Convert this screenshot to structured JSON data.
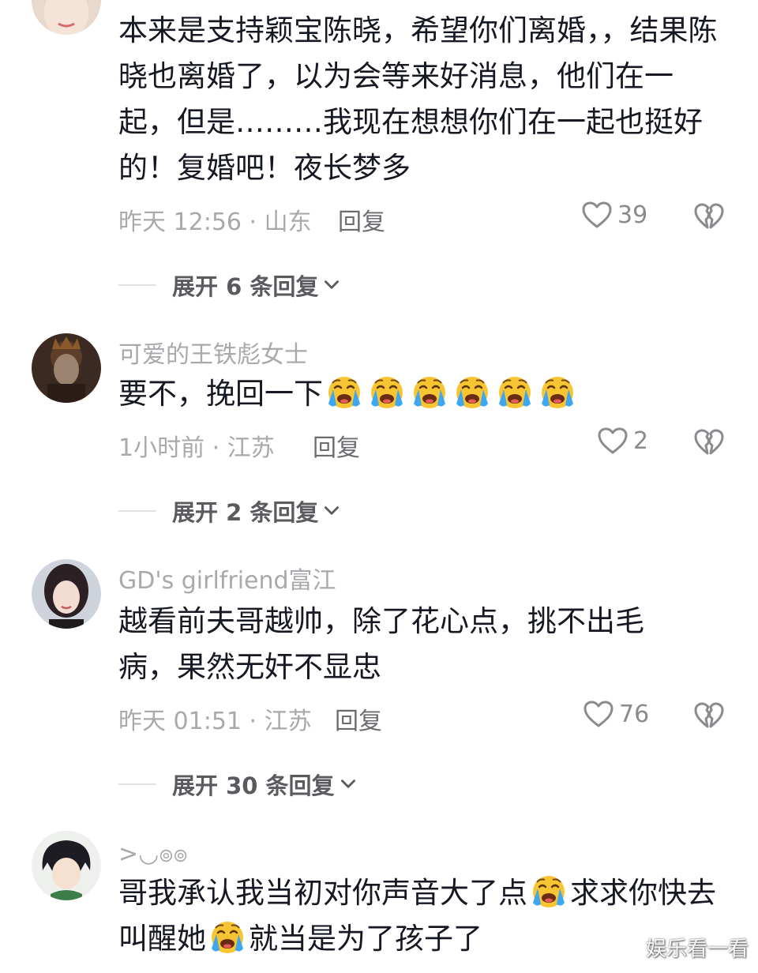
{
  "comments": [
    {
      "username": "",
      "text": "本来是支持颖宝陈晓，希望你们离婚，，结果陈晓也离婚了，以为会等来好消息，他们在一起，但是………我现在想想你们在一起也挺好的！复婚吧！夜长梦多",
      "meta": "昨天 12:56 · 山东",
      "reply": "回复",
      "likes": "39",
      "expand": "展开 6 条回复"
    },
    {
      "username": "可爱的王铁彪女士",
      "text": "要不，挽回一下",
      "emoji_count": 6,
      "meta": "1小时前 · 江苏",
      "reply": "回复",
      "likes": "2",
      "expand": "展开 2 条回复"
    },
    {
      "username": "GD's girlfriend富江",
      "text": "越看前夫哥越帅，除了花心点，挑不出毛病，果然无奸不显忠",
      "meta": "昨天 01:51 · 江苏",
      "reply": "回复",
      "likes": "76",
      "expand": "展开 30 条回复"
    },
    {
      "username": ">◡๏๏",
      "text_part1": "哥我承认我当初对你声音大了点",
      "text_part2": "求求你快去叫醒她",
      "text_part3": "就当是为了孩子了"
    }
  ],
  "watermark": "娱乐看一看",
  "icons": {
    "like": "heart-outline-icon",
    "dislike": "broken-heart-icon",
    "expand": "chevron-down-icon",
    "emoji": "crying-face-emoji"
  },
  "colors": {
    "text": "#161823",
    "muted": "#a9a9ad",
    "emoji_yellow": "#f7c531",
    "emoji_tears": "#3fa7f0"
  }
}
